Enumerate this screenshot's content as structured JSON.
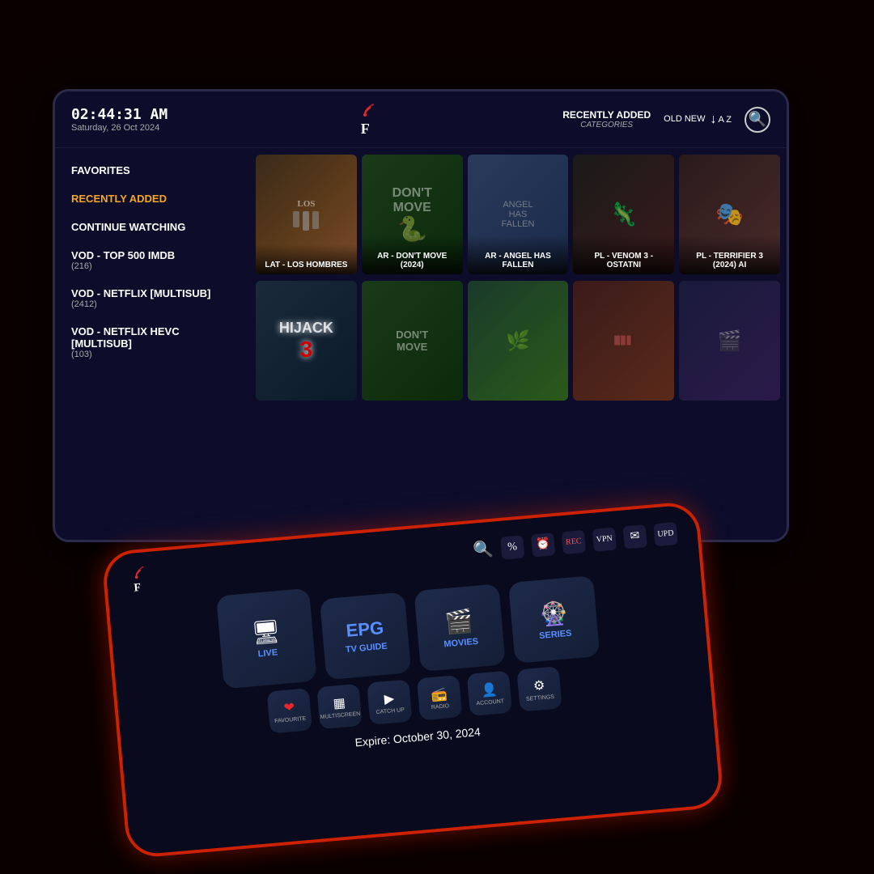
{
  "background": {
    "color": "#0a0000"
  },
  "tablet": {
    "header": {
      "time": "02:44:31 AM",
      "date": "Saturday, 26 Oct 2024",
      "nav_recently_added": "RECENTLY ADDED",
      "nav_categories": "CATEGORIES",
      "nav_old_new": "OLD NEW",
      "nav_az": "A Z"
    },
    "sidebar": {
      "items": [
        {
          "label": "FAVORITES",
          "active": false
        },
        {
          "label": "RECENTLY ADDED",
          "active": true
        },
        {
          "label": "CONTINUE WATCHING",
          "active": false
        },
        {
          "label": "VOD - TOP 500 IMDB",
          "sub": "(216)",
          "active": false
        },
        {
          "label": "VOD - NETFLIX [MULTISUB]",
          "sub": "(2412)",
          "active": false
        },
        {
          "label": "VOD - NETFLIX HEVC [MULTISUB]",
          "sub": "(103)",
          "active": false
        }
      ]
    },
    "movies_row1": [
      {
        "title": "LAT - LOS HOMBRES"
      },
      {
        "title": "AR - DON'T MOVE (2024)"
      },
      {
        "title": "AR - ANGEL HAS FALLEN"
      },
      {
        "title": "PL - VENOM 3 - OSTATNI"
      },
      {
        "title": "PL - TERRIFIER 3 (2024) AI"
      }
    ],
    "movies_row2": [
      {
        "title": "HIJACK 3"
      },
      {
        "title": "DON'T MOVE"
      },
      {
        "title": ""
      },
      {
        "title": ""
      },
      {
        "title": ""
      }
    ]
  },
  "phone": {
    "logo_f": "F",
    "menu_items": [
      {
        "label": "LIVE",
        "icon": "🖥"
      },
      {
        "label": "TV GUIDE",
        "icon": "EPG"
      },
      {
        "label": "MOVIES",
        "icon": "🎬"
      },
      {
        "label": "SERIES",
        "icon": "🎡"
      }
    ],
    "small_items": [
      {
        "label": "FAVOURITE",
        "icon": "❤"
      },
      {
        "label": "MULTISCREEN",
        "icon": "▦"
      },
      {
        "label": "CATCH UP",
        "icon": "▶"
      },
      {
        "label": "RADIO",
        "icon": "📻"
      },
      {
        "label": "ACCOUNT",
        "icon": "👤"
      },
      {
        "label": "SETTINGS",
        "icon": "⚙"
      }
    ],
    "expire_text": "Expire: October 30, 2024",
    "header_icons": [
      {
        "label": "search",
        "icon": "🔍"
      },
      {
        "label": "percent",
        "icon": "%"
      },
      {
        "label": "alarm",
        "icon": "⏰"
      },
      {
        "label": "rec",
        "icon": "🔴"
      },
      {
        "label": "vpn",
        "icon": "🔒"
      },
      {
        "label": "msg",
        "icon": "✉"
      },
      {
        "label": "update",
        "icon": "🔄"
      }
    ]
  }
}
